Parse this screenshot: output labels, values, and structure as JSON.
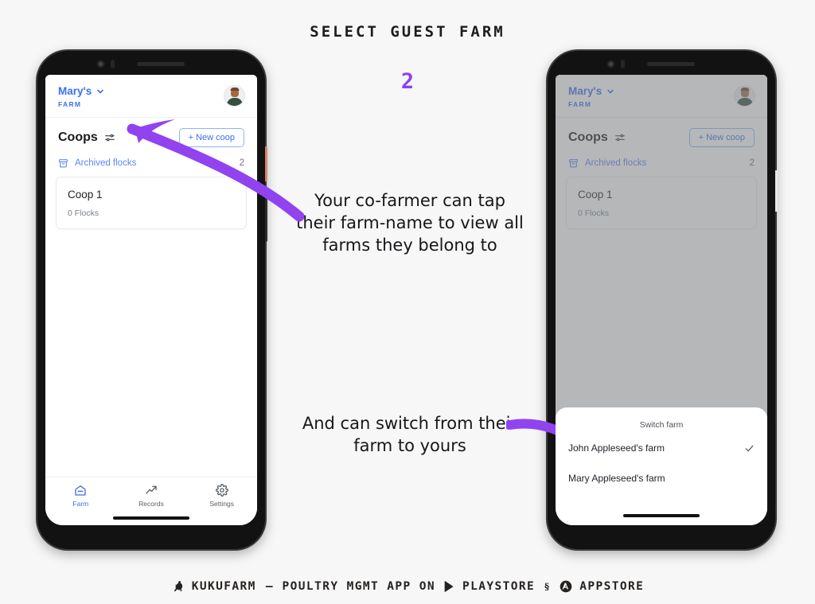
{
  "header": {
    "title": "SELECT GUEST FARM",
    "step": "2"
  },
  "colors": {
    "accent_purple": "#8f3ff2",
    "link_blue": "#3c6ef0",
    "page_bg": "#f7f7f7"
  },
  "app": {
    "farm": {
      "name": "Mary's",
      "subtitle": "FARM",
      "chevron_icon": "chevron-down-icon",
      "avatar_icon": "user-avatar"
    },
    "coops_section": {
      "title": "Coops",
      "filter_icon": "tune-sliders-icon",
      "new_coop_label": "+ New coop"
    },
    "archived": {
      "icon": "archive-box-icon",
      "label": "Archived flocks",
      "count": "2"
    },
    "coops": [
      {
        "name": "Coop 1",
        "flocks": "0 Flocks"
      }
    ],
    "bottom_nav": [
      {
        "label": "Farm",
        "icon": "home-farm-icon",
        "active": true
      },
      {
        "label": "Records",
        "icon": "trending-up-icon",
        "active": false
      },
      {
        "label": "Settings",
        "icon": "gear-icon",
        "active": false
      }
    ]
  },
  "sheet": {
    "title": "Switch farm",
    "items": [
      {
        "label": "John Appleseed's farm",
        "selected": true,
        "check_icon": "check-icon"
      },
      {
        "label": "Mary Appleseed's farm",
        "selected": false,
        "check_icon": ""
      }
    ]
  },
  "annotations": [
    {
      "text": "Your co-farmer can tap their farm-name to view all farms they belong to"
    },
    {
      "text": "And can switch from their farm to yours"
    }
  ],
  "footer": {
    "brand_icon": "chicken-icon",
    "brand": "KUKUFARM",
    "dash": "—",
    "tagline": "POULTRY MGMT APP ON",
    "playstore_icon": "google-play-icon",
    "playstore": "PLAYSTORE",
    "separator_icon": "section-sign-icon",
    "appstore_icon": "app-store-icon",
    "appstore": "APPSTORE"
  }
}
